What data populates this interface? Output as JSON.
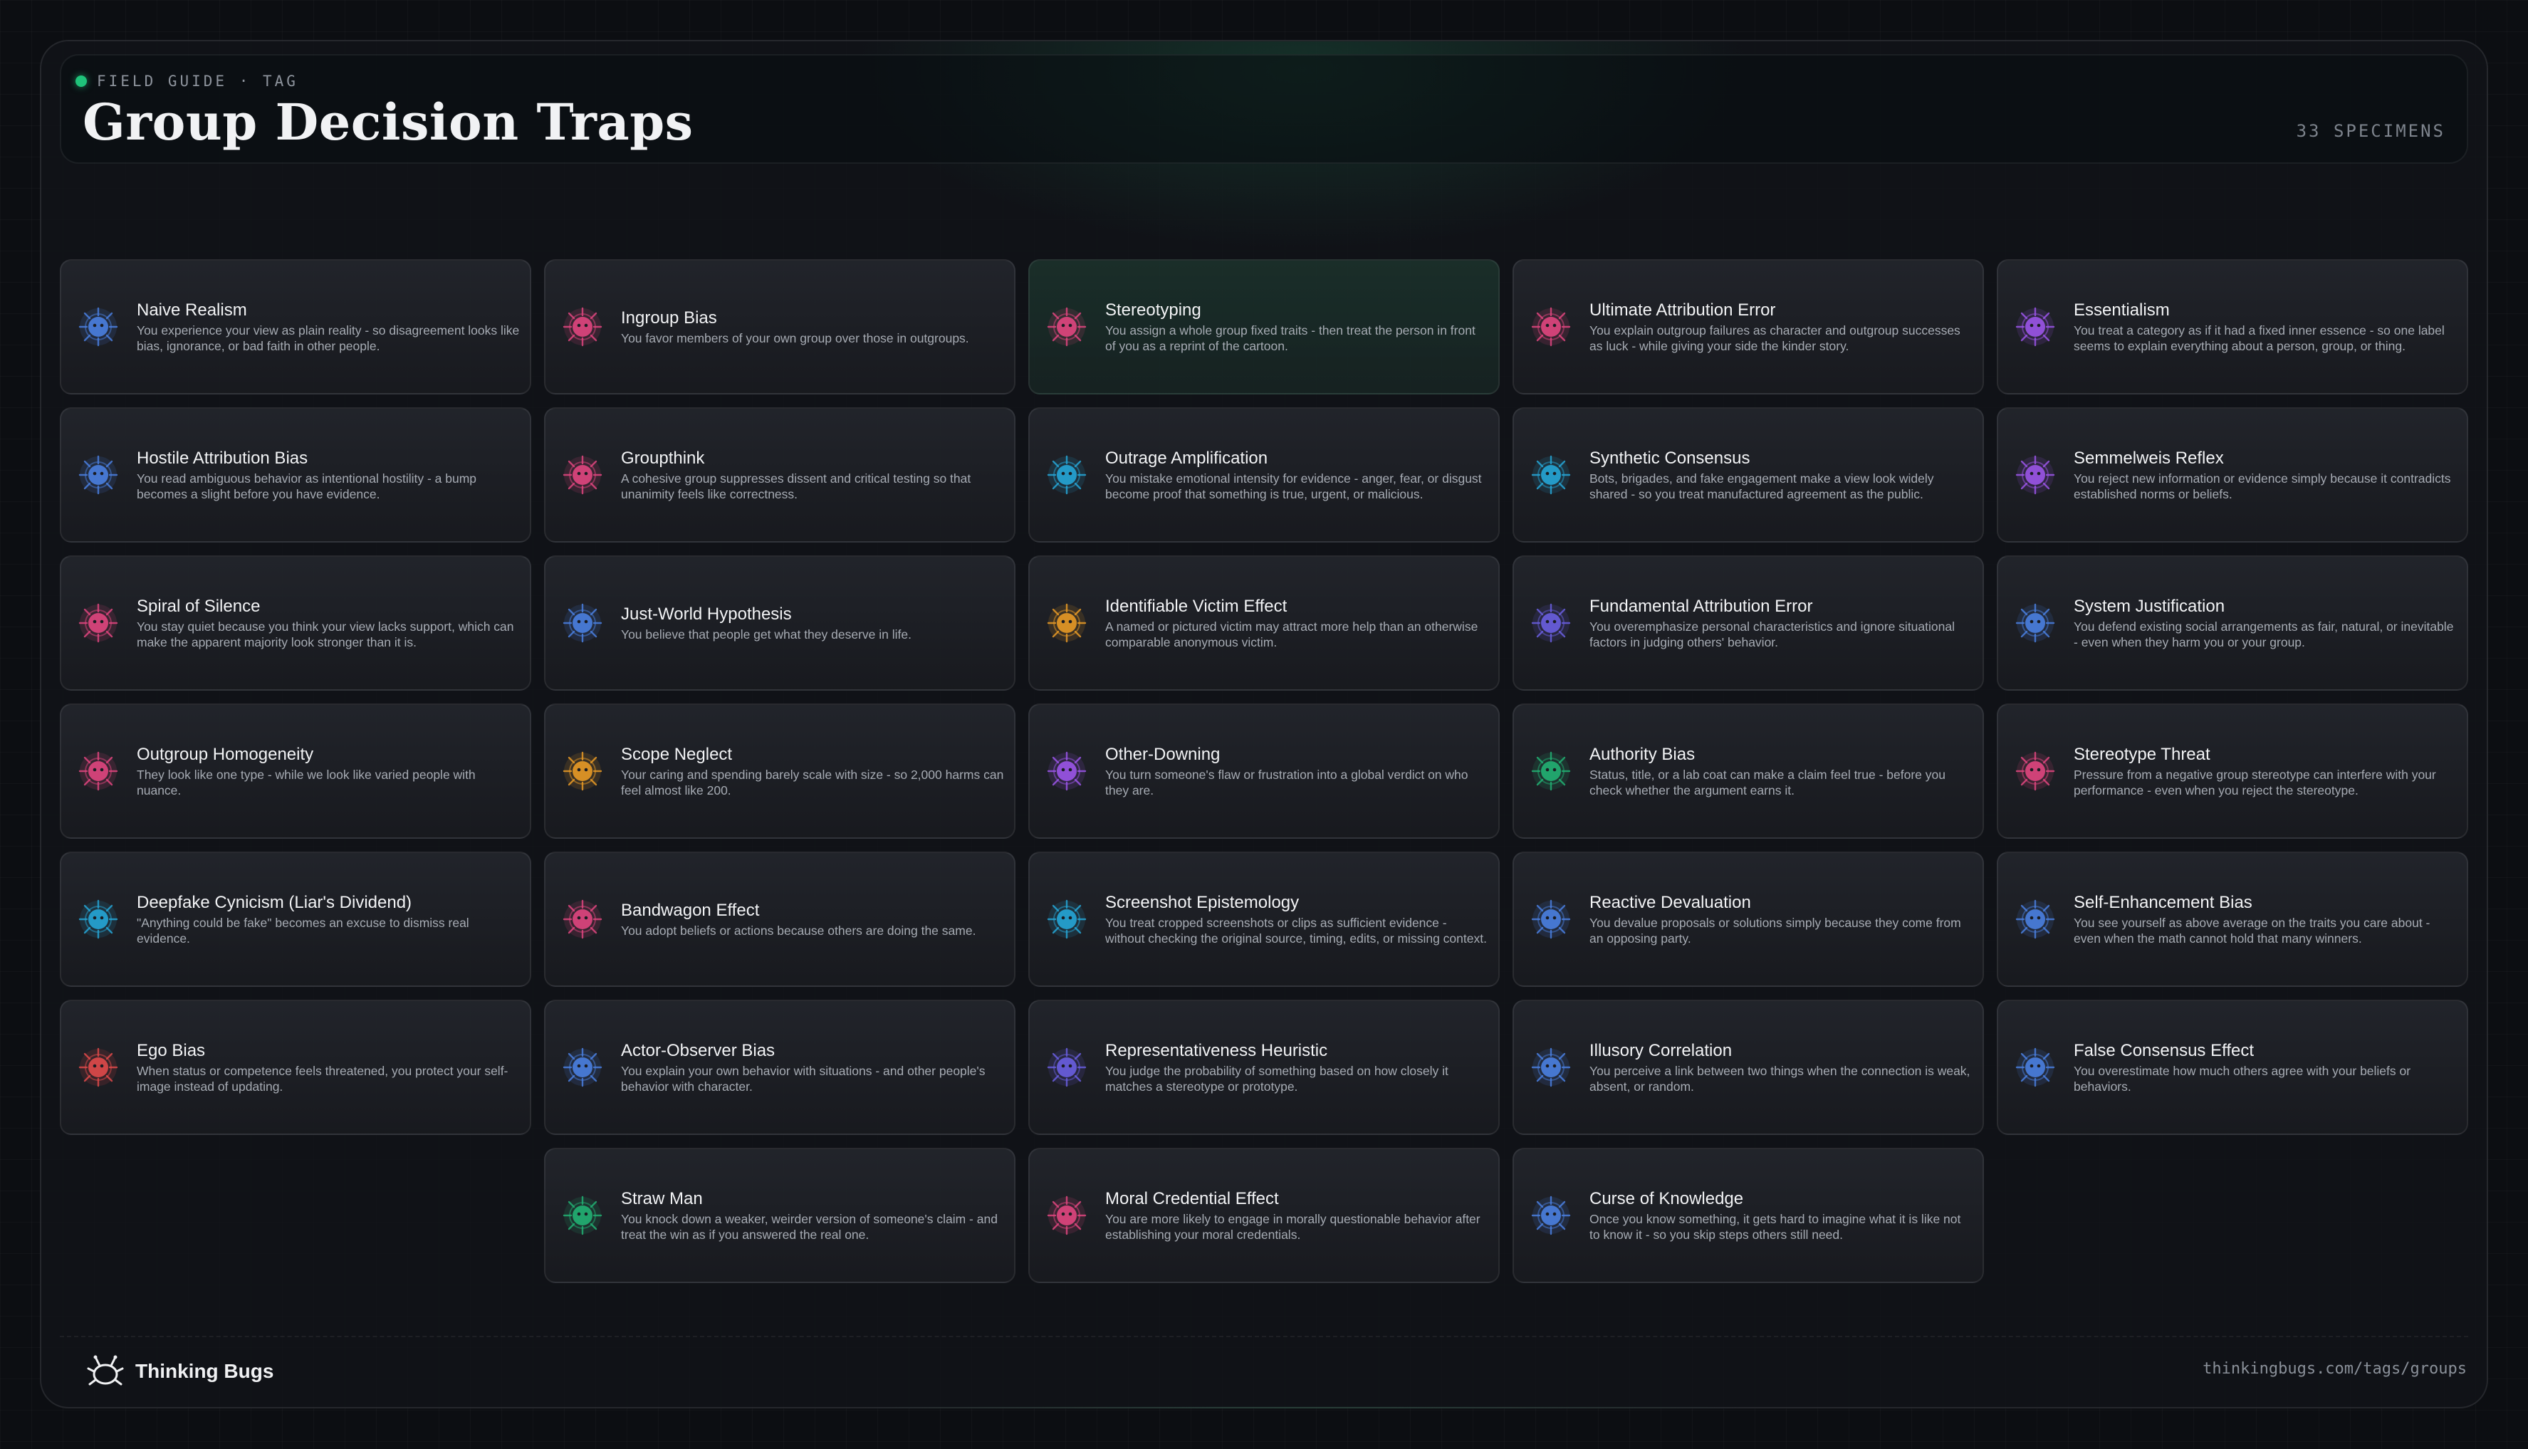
{
  "header": {
    "eyebrow": "FIELD GUIDE · TAG",
    "title": "Group Decision Traps",
    "count": "33 SPECIMENS"
  },
  "colors": {
    "blue": "#4a7fe0",
    "pink": "#e0467f",
    "purple": "#9b55e8",
    "cyan": "#26a6d6",
    "indigo": "#6a5fe0",
    "orange": "#e89a26",
    "green": "#22b073",
    "red": "#e04a4a",
    "accent": "#1fc37a"
  },
  "cards": [
    {
      "name": "Naive Realism",
      "desc": "You experience your view as plain reality - so disagreement looks like bias, ignorance, or bad faith in other people.",
      "color": "blue",
      "glow": false
    },
    {
      "name": "Ingroup Bias",
      "desc": "You favor members of your own group over those in outgroups.",
      "color": "pink",
      "glow": false
    },
    {
      "name": "Stereotyping",
      "desc": "You assign a whole group fixed traits - then treat the person in front of you as a reprint of the cartoon.",
      "color": "pink",
      "glow": true
    },
    {
      "name": "Ultimate Attribution Error",
      "desc": "You explain outgroup failures as character and outgroup successes as luck - while giving your side the kinder story.",
      "color": "pink",
      "glow": false
    },
    {
      "name": "Essentialism",
      "desc": "You treat a category as if it had a fixed inner essence - so one label seems to explain everything about a person, group, or thing.",
      "color": "purple",
      "glow": false
    },
    {
      "name": "Hostile Attribution Bias",
      "desc": "You read ambiguous behavior as intentional hostility - a bump becomes a slight before you have evidence.",
      "color": "blue",
      "glow": false
    },
    {
      "name": "Groupthink",
      "desc": "A cohesive group suppresses dissent and critical testing so that unanimity feels like correctness.",
      "color": "pink",
      "glow": false
    },
    {
      "name": "Outrage Amplification",
      "desc": "You mistake emotional intensity for evidence - anger, fear, or disgust become proof that something is true, urgent, or malicious.",
      "color": "cyan",
      "glow": false
    },
    {
      "name": "Synthetic Consensus",
      "desc": "Bots, brigades, and fake engagement make a view look widely shared - so you treat manufactured agreement as the public.",
      "color": "cyan",
      "glow": false
    },
    {
      "name": "Semmelweis Reflex",
      "desc": "You reject new information or evidence simply because it contradicts established norms or beliefs.",
      "color": "purple",
      "glow": false
    },
    {
      "name": "Spiral of Silence",
      "desc": "You stay quiet because you think your view lacks support, which can make the apparent majority look stronger than it is.",
      "color": "pink",
      "glow": false
    },
    {
      "name": "Just-World Hypothesis",
      "desc": "You believe that people get what they deserve in life.",
      "color": "blue",
      "glow": false
    },
    {
      "name": "Identifiable Victim Effect",
      "desc": "A named or pictured victim may attract more help than an otherwise comparable anonymous victim.",
      "color": "orange",
      "glow": false
    },
    {
      "name": "Fundamental Attribution Error",
      "desc": "You overemphasize personal characteristics and ignore situational factors in judging others' behavior.",
      "color": "indigo",
      "glow": false
    },
    {
      "name": "System Justification",
      "desc": "You defend existing social arrangements as fair, natural, or inevitable - even when they harm you or your group.",
      "color": "blue",
      "glow": false
    },
    {
      "name": "Outgroup Homogeneity",
      "desc": "They look like one type - while we look like varied people with nuance.",
      "color": "pink",
      "glow": false
    },
    {
      "name": "Scope Neglect",
      "desc": "Your caring and spending barely scale with size - so 2,000 harms can feel almost like 200.",
      "color": "orange",
      "glow": false
    },
    {
      "name": "Other-Downing",
      "desc": "You turn someone's flaw or frustration into a global verdict on who they are.",
      "color": "purple",
      "glow": false
    },
    {
      "name": "Authority Bias",
      "desc": "Status, title, or a lab coat can make a claim feel true - before you check whether the argument earns it.",
      "color": "green",
      "glow": false
    },
    {
      "name": "Stereotype Threat",
      "desc": "Pressure from a negative group stereotype can interfere with your performance - even when you reject the stereotype.",
      "color": "pink",
      "glow": false
    },
    {
      "name": "Deepfake Cynicism (Liar's Dividend)",
      "desc": "\"Anything could be fake\" becomes an excuse to dismiss real evidence.",
      "color": "cyan",
      "glow": false
    },
    {
      "name": "Bandwagon Effect",
      "desc": "You adopt beliefs or actions because others are doing the same.",
      "color": "pink",
      "glow": false
    },
    {
      "name": "Screenshot Epistemology",
      "desc": "You treat cropped screenshots or clips as sufficient evidence - without checking the original source, timing, edits, or missing context.",
      "color": "cyan",
      "glow": false
    },
    {
      "name": "Reactive Devaluation",
      "desc": "You devalue proposals or solutions simply because they come from an opposing party.",
      "color": "blue",
      "glow": false
    },
    {
      "name": "Self-Enhancement Bias",
      "desc": "You see yourself as above average on the traits you care about - even when the math cannot hold that many winners.",
      "color": "blue",
      "glow": false
    },
    {
      "name": "Ego Bias",
      "desc": "When status or competence feels threatened, you protect your self-image instead of updating.",
      "color": "red",
      "glow": false
    },
    {
      "name": "Actor-Observer Bias",
      "desc": "You explain your own behavior with situations - and other people's behavior with character.",
      "color": "blue",
      "glow": false
    },
    {
      "name": "Representativeness Heuristic",
      "desc": "You judge the probability of something based on how closely it matches a stereotype or prototype.",
      "color": "indigo",
      "glow": false
    },
    {
      "name": "Illusory Correlation",
      "desc": "You perceive a link between two things when the connection is weak, absent, or random.",
      "color": "blue",
      "glow": false
    },
    {
      "name": "False Consensus Effect",
      "desc": "You overestimate how much others agree with your beliefs or behaviors.",
      "color": "blue",
      "glow": false
    },
    {
      "name": "Straw Man",
      "desc": "You knock down a weaker, weirder version of someone's claim - and treat the win as if you answered the real one.",
      "color": "green",
      "glow": false
    },
    {
      "name": "Moral Credential Effect",
      "desc": "You are more likely to engage in morally questionable behavior after establishing your moral credentials.",
      "color": "pink",
      "glow": false
    },
    {
      "name": "Curse of Knowledge",
      "desc": "Once you know something, it gets hard to imagine what it is like not to know it - so you skip steps others still need.",
      "color": "blue",
      "glow": false
    }
  ],
  "footer": {
    "brand": "Thinking Bugs",
    "url": "thinkingbugs.com/tags/groups"
  }
}
